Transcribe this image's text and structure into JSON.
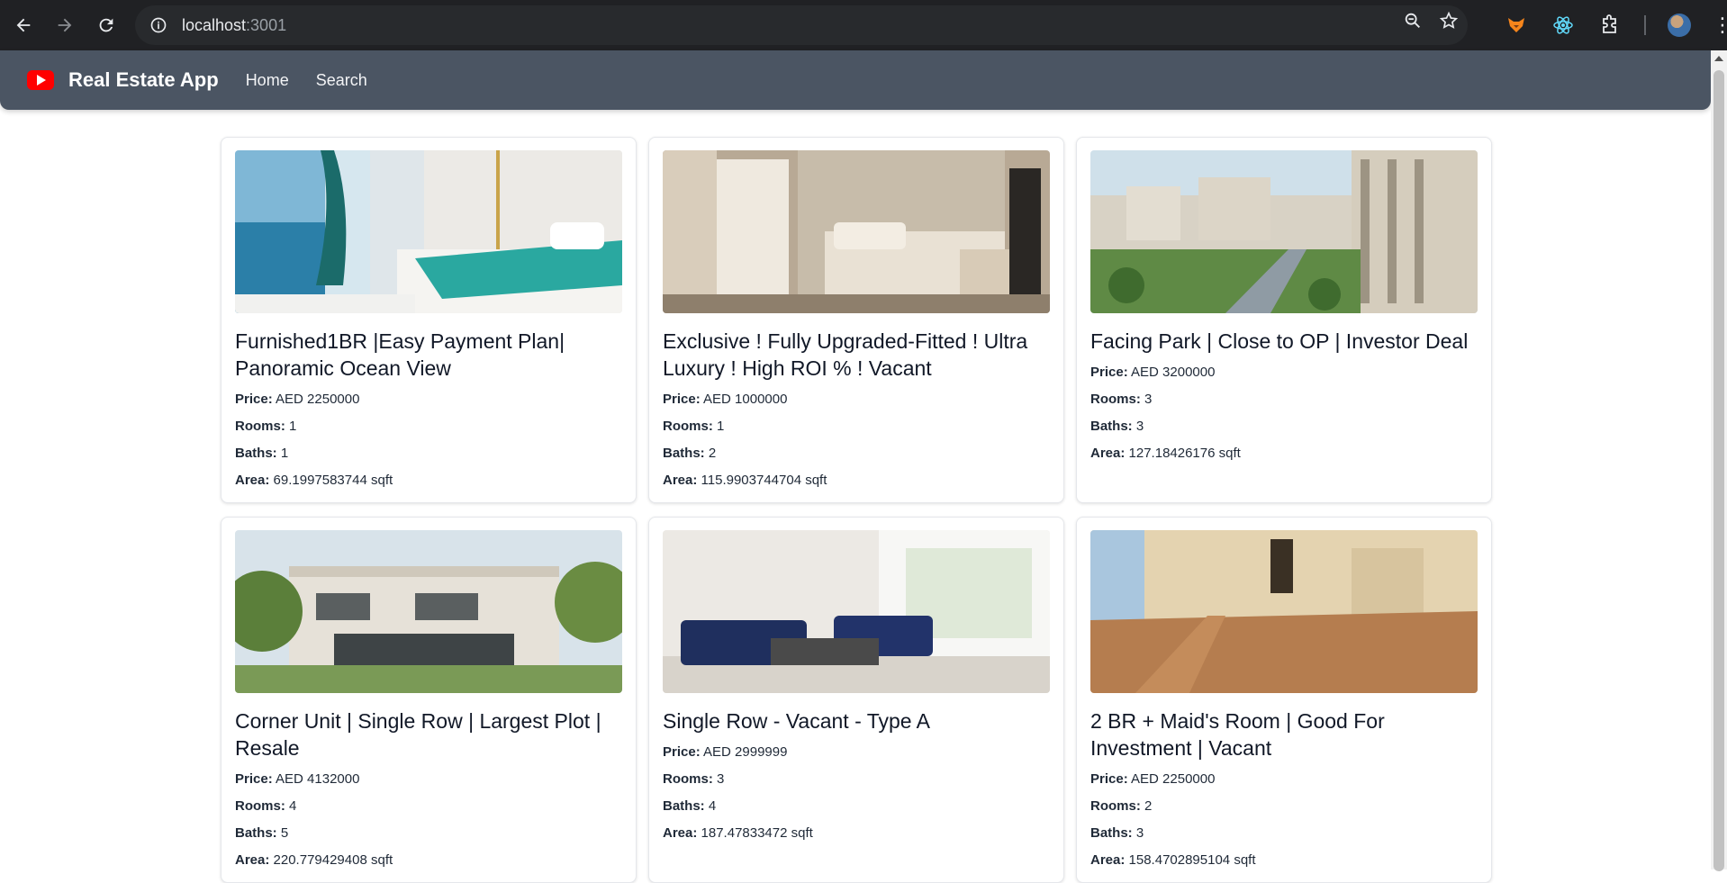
{
  "browser": {
    "url_host": "localhost",
    "url_port": ":3001"
  },
  "app": {
    "brand": "Real Estate App",
    "nav": [
      "Home",
      "Search"
    ]
  },
  "labels": {
    "price": "Price:",
    "rooms": "Rooms:",
    "baths": "Baths:",
    "area": "Area:"
  },
  "listings": [
    {
      "title": "Furnished1BR |Easy Payment Plan| Panoramic Ocean View",
      "price": "AED 2250000",
      "rooms": "1",
      "baths": "1",
      "area": "69.1997583744 sqft"
    },
    {
      "title": "Exclusive ! Fully Upgraded-Fitted ! Ultra Luxury ! High ROI % ! Vacant",
      "price": "AED 1000000",
      "rooms": "1",
      "baths": "2",
      "area": "115.9903744704 sqft"
    },
    {
      "title": "Facing Park | Close to OP | Investor Deal",
      "price": "AED 3200000",
      "rooms": "3",
      "baths": "3",
      "area": "127.18426176 sqft"
    },
    {
      "title": "Corner Unit | Single Row | Largest Plot | Resale",
      "price": "AED 4132000",
      "rooms": "4",
      "baths": "5",
      "area": "220.779429408 sqft"
    },
    {
      "title": "Single Row - Vacant - Type A",
      "price": "AED 2999999",
      "rooms": "3",
      "baths": "4",
      "area": "187.47833472 sqft"
    },
    {
      "title": "2 BR + Maid's Room | Good For Investment | Vacant",
      "price": "AED 2250000",
      "rooms": "2",
      "baths": "3",
      "area": "158.4702895104 sqft"
    }
  ],
  "colors": {
    "appbar": "#4b5563",
    "logo": "#ff0000",
    "chrome": "#202124"
  }
}
